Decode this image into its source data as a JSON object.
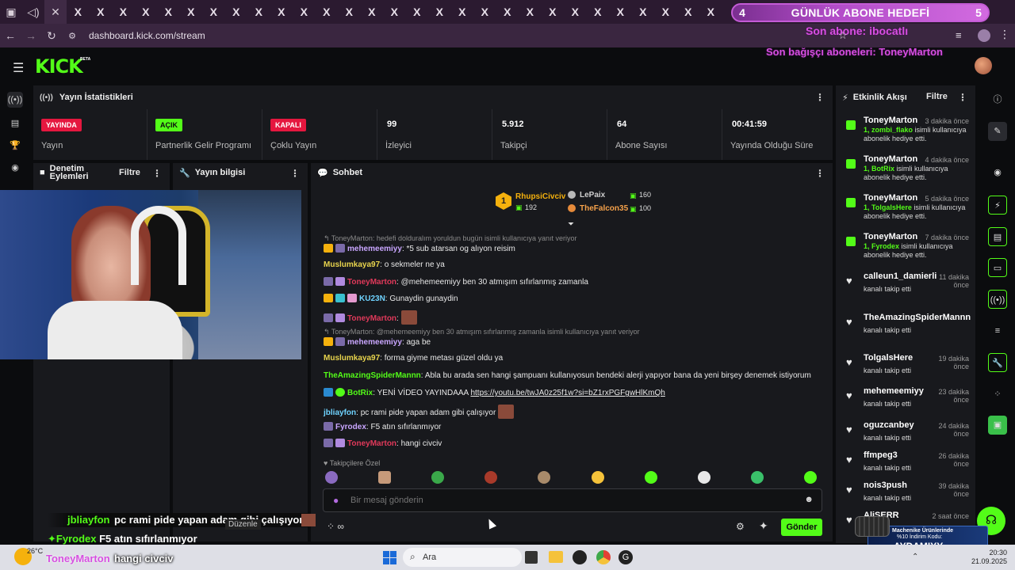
{
  "browser": {
    "url": "dashboard.kick.com/stream",
    "tab_count": 29
  },
  "overlay": {
    "goal_left": "4",
    "goal_title": "GÜNLÜK ABONE HEDEFİ",
    "goal_right": "5",
    "last_sub": "Son abone: ibocatlı",
    "last_gift": "Son bağışçı aboneleri: ToneyMarton",
    "chat_overlay": [
      {
        "user": "jbliayfon",
        "msg": "pc rami pide yapan adam gibi çalışıyor"
      },
      {
        "user": "Fyrodex",
        "msg": "F5 atın sıfırlanmıyor"
      },
      {
        "user": "ToneyMarton",
        "msg": "hangi civciv"
      }
    ],
    "duzenle": "Düzenle",
    "promo_line1": "Machenike Ürünlerinde",
    "promo_line2": "%10 İndirim Kodu:",
    "promo_code": "AYDAMIYY"
  },
  "stats": {
    "title": "Yayın İstatistikleri",
    "items": [
      {
        "badge": "YAYINDA",
        "label": "Yayın"
      },
      {
        "badge": "AÇIK",
        "label": "Partnerlik Gelir Programı"
      },
      {
        "badge": "KAPALI",
        "label": "Çoklu Yayın"
      },
      {
        "value": "99",
        "label": "İzleyici"
      },
      {
        "value": "5.912",
        "label": "Takipçi"
      },
      {
        "value": "64",
        "label": "Abone Sayısı"
      },
      {
        "value": "00:41:59",
        "label": "Yayında Olduğu Süre"
      }
    ]
  },
  "mod_panel": {
    "title": "Denetim Eylemleri",
    "filter": "Filtre"
  },
  "info_panel": {
    "title": "Yayın bilgisi"
  },
  "chat": {
    "title": "Sohbet",
    "leaders": [
      {
        "rank": "1",
        "name": "RhupsiCivciv",
        "count": "192"
      },
      {
        "rank": "2",
        "name": "LePaix",
        "count": "160"
      },
      {
        "rank": "3",
        "name": "TheFalcon35",
        "count": "100"
      }
    ],
    "lines": [
      {
        "ref": "ToneyMarton: hedefi dolduralım yoruldun bugün isimli kullanıcıya yanıt veriyor"
      },
      {
        "user": "mehemeemiyy",
        "msg": "*5 sub atarsan og alıyon reisim",
        "color": "#c9a6ff"
      },
      {
        "user": "Muslumkaya97",
        "msg": "o sekmeler ne ya",
        "color": "#e8d44d"
      },
      {
        "user": "ToneyMarton",
        "msg": "@mehemeemiyy ben 30 atmışım sıfırlanmış zamanla",
        "color": "#e0395a"
      },
      {
        "user": "KU23N",
        "msg": "Gunaydin gunaydin",
        "color": "#6fd3ff"
      },
      {
        "user": "ToneyMarton",
        "msg": "",
        "color": "#e0395a"
      },
      {
        "ref": "ToneyMarton: @mehemeemiyy ben 30 atmışım sıfırlanmış zamanla isimli kullanıcıya yanıt veriyor"
      },
      {
        "user": "mehemeemiyy",
        "msg": "aga be",
        "color": "#c9a6ff"
      },
      {
        "user": "Muslumkaya97",
        "msg": "forma giyme metası güzel oldu ya",
        "color": "#e8d44d"
      },
      {
        "user": "TheAmazingSpiderMannn",
        "msg": "Abla bu arada sen hangi şampuanı kullanıyosun bendeki alerji yapıyor bana da yeni birşey denemek istiyorum",
        "color": "#53fc18"
      },
      {
        "user": "BotRix",
        "msg": "YENİ VİDEO YAYINDAAA",
        "link": "https://youtu.be/twJA0z25f1w?si=bZ1rxPGFgwHlKmQh",
        "color": "#53fc18"
      },
      {
        "user": "jbliayfon",
        "msg": "pc rami pide yapan adam gibi çalışıyor",
        "color": "#6fd3ff"
      },
      {
        "user": "Fyrodex",
        "msg": "F5 atın sıfırlanmıyor",
        "color": "#c9a6ff"
      },
      {
        "user": "ToneyMarton",
        "msg": "hangi civciv",
        "color": "#e0395a"
      }
    ],
    "follower_only": "Takipçilere Özel",
    "input_placeholder": "Bir mesaj gönderin",
    "send": "Gönder"
  },
  "events": {
    "title": "Etkinlik Akışı",
    "filter": "Filtre",
    "items": [
      {
        "name": "ToneyMarton",
        "time": "3 dakika önce",
        "gift": "1, zombi_flako",
        "text": "isimli kullanıcıya abonelik hediye etti.",
        "type": "gift"
      },
      {
        "name": "ToneyMarton",
        "time": "4 dakika önce",
        "gift": "1, BotRix",
        "text": "isimli kullanıcıya abonelik hediye etti.",
        "type": "gift"
      },
      {
        "name": "ToneyMarton",
        "time": "5 dakika önce",
        "gift": "1, TolgalsHere",
        "text": "isimli kullanıcıya abonelik hediye etti.",
        "type": "gift"
      },
      {
        "name": "ToneyMarton",
        "time": "7 dakika önce",
        "gift": "1, Fyrodex",
        "text": "isimli kullanıcıya abonelik hediye etti.",
        "type": "gift"
      },
      {
        "name": "calleun1_damierli",
        "time": "11 dakika önce",
        "text": "kanalı takip etti",
        "type": "follow"
      },
      {
        "name": "TheAmazingSpiderMannn",
        "time": "",
        "text": "kanalı takip etti",
        "type": "follow"
      },
      {
        "name": "TolgalsHere",
        "time": "19 dakika önce",
        "text": "kanalı takip etti",
        "type": "follow"
      },
      {
        "name": "mehemeemiyy",
        "time": "23 dakika önce",
        "text": "kanalı takip etti",
        "type": "follow"
      },
      {
        "name": "oguzcanbey",
        "time": "24 dakika önce",
        "text": "kanalı takip etti",
        "type": "follow"
      },
      {
        "name": "ffmpeg3",
        "time": "26 dakika önce",
        "text": "kanalı takip etti",
        "type": "follow"
      },
      {
        "name": "nois3push",
        "time": "39 dakika önce",
        "text": "kanalı takip etti",
        "type": "follow"
      },
      {
        "name": "AliSERR",
        "time": "2 saat önce",
        "text": "",
        "type": "follow"
      }
    ]
  },
  "taskbar": {
    "weather": "26°C",
    "search": "Ara",
    "time": "20:30",
    "date": "21.09.2025"
  },
  "colors": {
    "kick_green": "#53fc18",
    "live_red": "#e5173f",
    "panel": "#18191d",
    "bg": "#0b0c0e"
  }
}
